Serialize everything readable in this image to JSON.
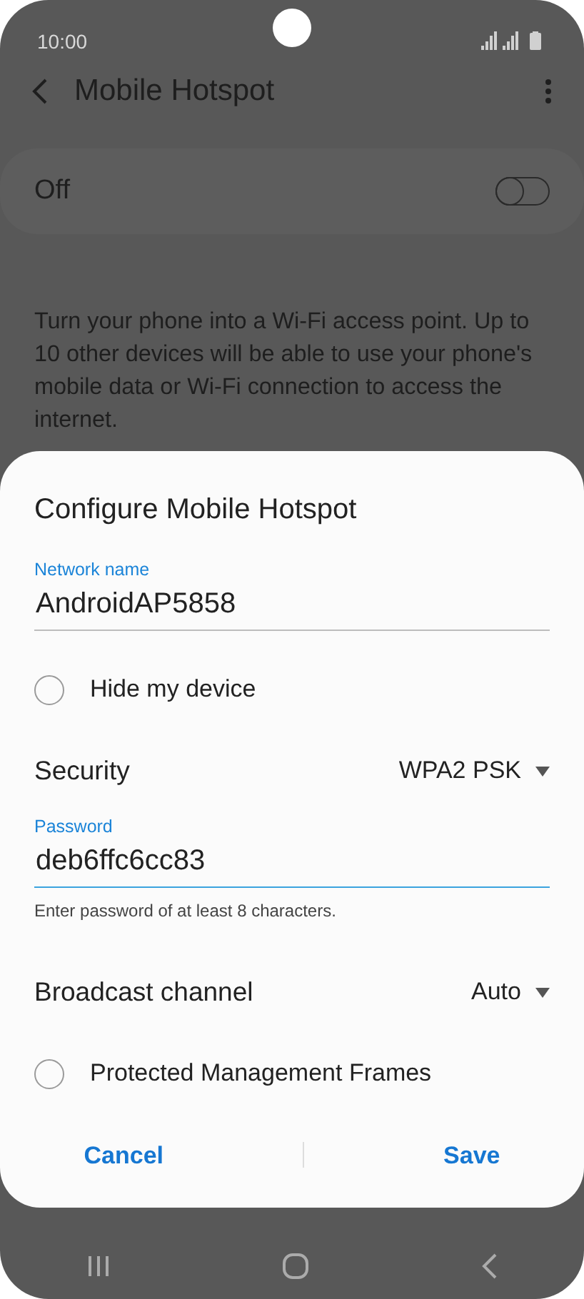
{
  "status_bar": {
    "time": "10:00"
  },
  "header": {
    "title": "Mobile Hotspot"
  },
  "master_switch": {
    "label": "Off",
    "on": false
  },
  "description": "Turn your phone into a Wi-Fi access point. Up to 10 other devices will be able to use your phone's mobile data or Wi-Fi connection to access the internet.",
  "dialog": {
    "title": "Configure Mobile Hotspot",
    "rows": [
      {
        "kind": "field",
        "label": "Network name",
        "value": "AndroidAP5858",
        "focused": false
      },
      {
        "kind": "radio",
        "label": "Hide my device",
        "checked": false
      },
      {
        "kind": "dropdown",
        "label": "Security",
        "value": "WPA2 PSK"
      },
      {
        "kind": "field",
        "label": "Password",
        "value": "deb6ffc6cc83",
        "focused": true,
        "helper": "Enter password of at least 8 characters."
      },
      {
        "kind": "dropdown",
        "label": "Broadcast channel",
        "value": "Auto"
      },
      {
        "kind": "radio",
        "label": "Protected Management Frames",
        "checked": false
      }
    ],
    "buttons": [
      "Cancel",
      "Save"
    ]
  }
}
